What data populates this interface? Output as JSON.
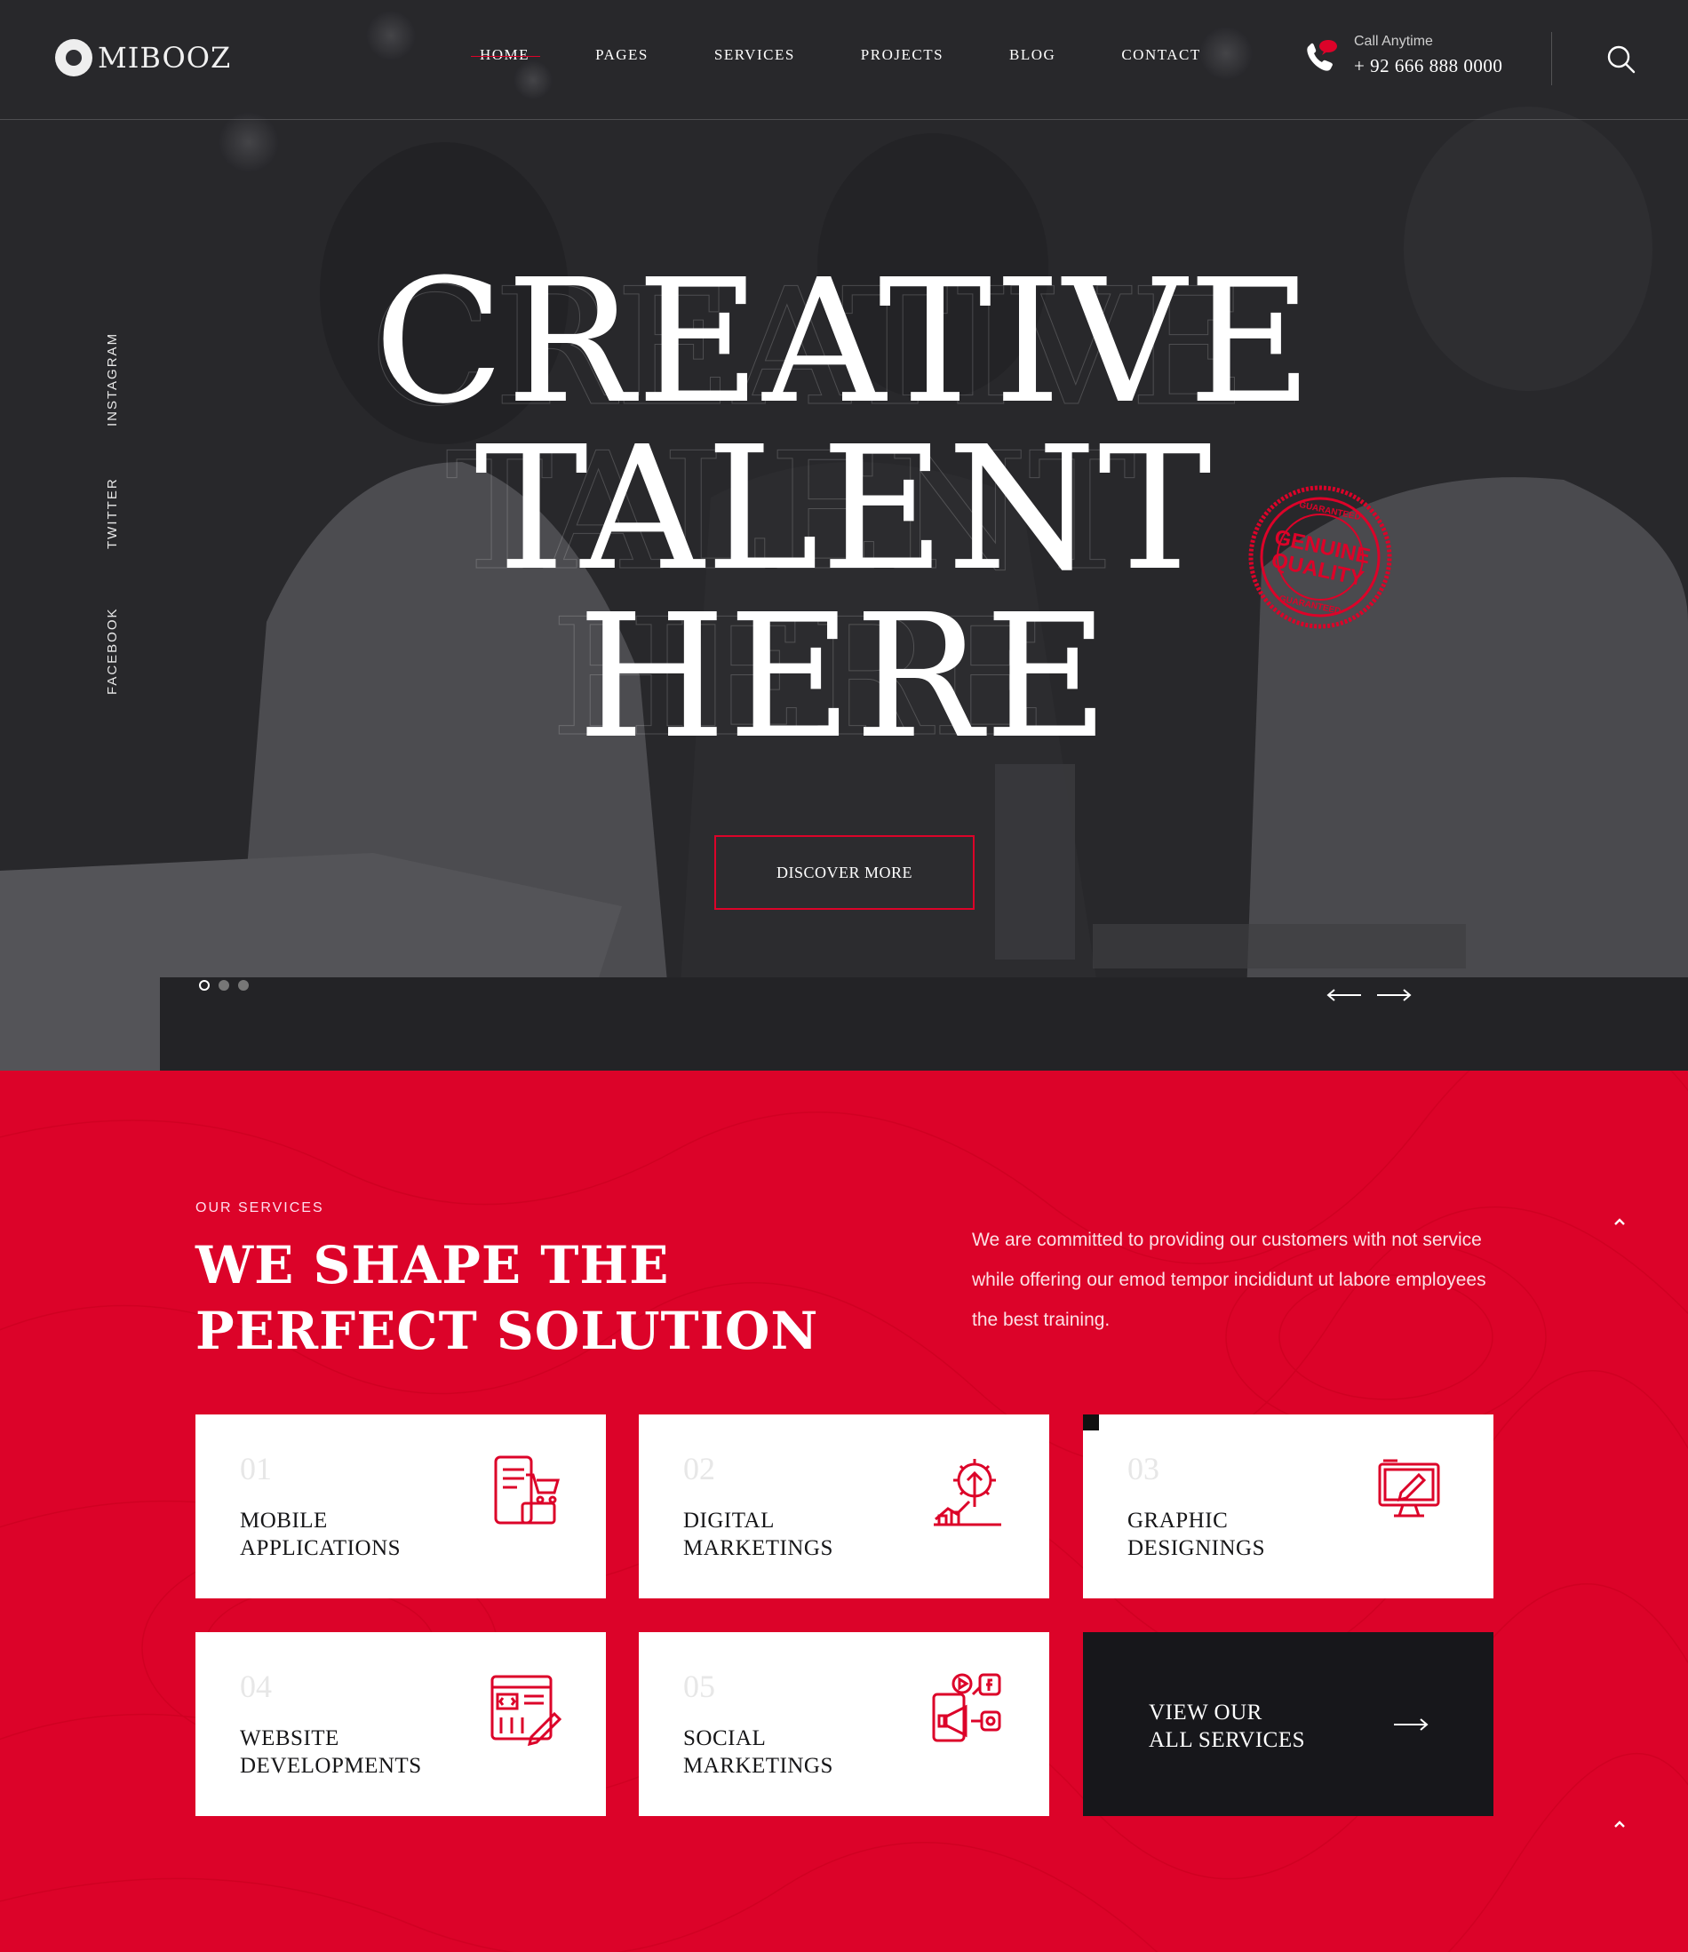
{
  "brand": {
    "name": "MIBOOZ"
  },
  "nav": {
    "items": [
      {
        "label": "HOME",
        "active": true
      },
      {
        "label": "PAGES"
      },
      {
        "label": "SERVICES"
      },
      {
        "label": "PROJECTS"
      },
      {
        "label": "BLOG"
      },
      {
        "label": "CONTACT"
      }
    ]
  },
  "call": {
    "label": "Call Anytime",
    "number": "+ 92 666 888 0000"
  },
  "social": {
    "instagram": "INSTAGRAM",
    "twitter": "TWITTER",
    "facebook": "FACEBOOK"
  },
  "hero": {
    "line1": "CREATIVE",
    "line2": "TALENT",
    "line3": "HERE",
    "stamp": {
      "top": "GUARANTEED",
      "main1": "GENUINE",
      "main2": "QUALITY",
      "bottom": "GUARANTEED"
    },
    "button": "DISCOVER MORE",
    "slides": 3,
    "active_slide": 1
  },
  "services": {
    "eyebrow": "OUR SERVICES",
    "title_line1": "WE SHAPE THE",
    "title_line2": "PERFECT SOLUTION",
    "text": "We are committed to providing our customers with not service while offering our emod tempor incididunt ut labore employees the best training.",
    "cards": [
      {
        "num": "01",
        "line1": "MOBILE",
        "line2": "APPLICATIONS",
        "icon": "mobile-shop-icon"
      },
      {
        "num": "02",
        "line1": "DIGITAL",
        "line2": "MARKETINGS",
        "icon": "growth-gear-icon"
      },
      {
        "num": "03",
        "line1": "GRAPHIC",
        "line2": "DESIGNINGS",
        "icon": "monitor-pencil-icon"
      },
      {
        "num": "04",
        "line1": "WEBSITE",
        "line2": "DEVELOPMENTS",
        "icon": "code-window-icon"
      },
      {
        "num": "05",
        "line1": "SOCIAL",
        "line2": "MARKETINGS",
        "icon": "megaphone-social-icon"
      }
    ],
    "view_all_line1": "VIEW OUR",
    "view_all_line2": "ALL SERVICES"
  },
  "colors": {
    "accent": "#dc0329",
    "dark": "#17171b",
    "white": "#ffffff"
  }
}
